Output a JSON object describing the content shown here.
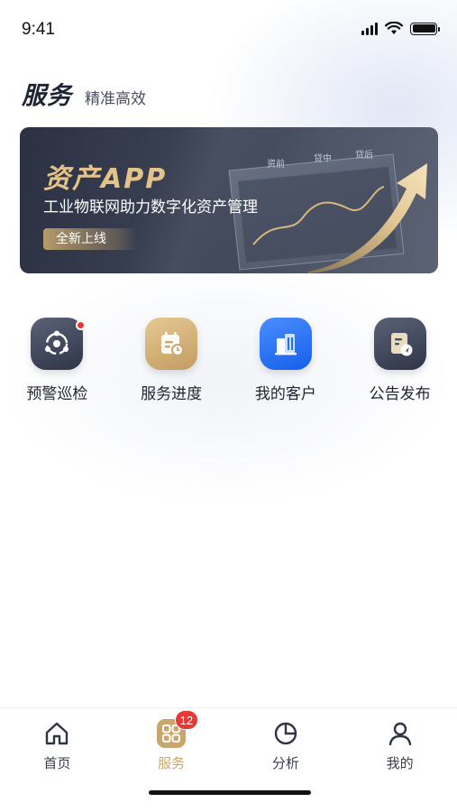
{
  "status_bar": {
    "time": "9:41"
  },
  "header": {
    "title": "服务",
    "subtitle": "精准高效"
  },
  "banner": {
    "title": "资产APP",
    "description": "工业物联网助力数字化资产管理",
    "tag": "全新上线",
    "art_labels": [
      "资前",
      "贷中",
      "贷后"
    ]
  },
  "services": [
    {
      "label": "预警巡检",
      "icon": "radar-inspect-icon",
      "has_dot": true,
      "color": "#3e4558"
    },
    {
      "label": "服务进度",
      "icon": "calendar-progress-icon",
      "has_dot": false,
      "color": "#cda86c"
    },
    {
      "label": "我的客户",
      "icon": "building-icon",
      "has_dot": false,
      "color": "#1e6ff5"
    },
    {
      "label": "公告发布",
      "icon": "notice-send-icon",
      "has_dot": false,
      "color": "#3e4558"
    }
  ],
  "tabbar": {
    "tabs": [
      {
        "label": "首页",
        "icon": "home-icon",
        "active": false
      },
      {
        "label": "服务",
        "icon": "grid-icon",
        "active": true,
        "badge": "12"
      },
      {
        "label": "分析",
        "icon": "pie-chart-icon",
        "active": false
      },
      {
        "label": "我的",
        "icon": "user-icon",
        "active": false
      }
    ]
  },
  "colors": {
    "accent": "#c9a66b",
    "badge": "#e53935",
    "text": "#1f2430",
    "banner": "#3d4456"
  }
}
